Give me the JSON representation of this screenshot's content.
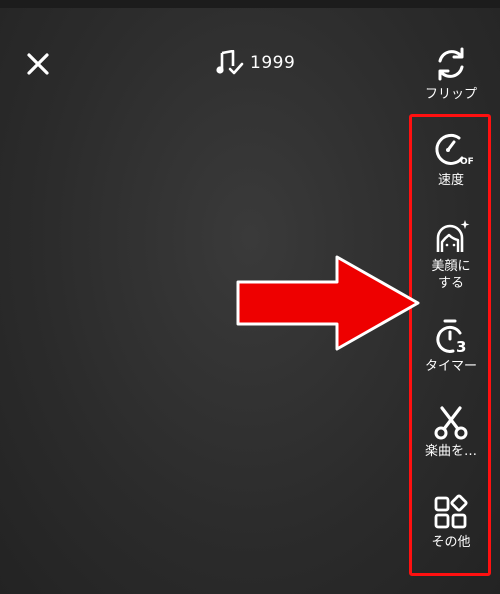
{
  "header": {
    "sound_label": "1999"
  },
  "toolbar": {
    "items": [
      {
        "label": "フリップ",
        "icon": "flip-icon"
      },
      {
        "label": "速度",
        "icon": "speed-icon",
        "badge": "OFF"
      },
      {
        "label": "美顔に\nする",
        "icon": "beauty-icon"
      },
      {
        "label": "タイマー",
        "icon": "timer-icon",
        "badge": "3"
      },
      {
        "label": "楽曲を…",
        "icon": "scissors-icon"
      },
      {
        "label": "その他",
        "icon": "more-icon"
      }
    ]
  },
  "colors": {
    "highlight": "#ff1010",
    "arrow_fill": "#ee0000",
    "arrow_outline": "#ffffff"
  }
}
